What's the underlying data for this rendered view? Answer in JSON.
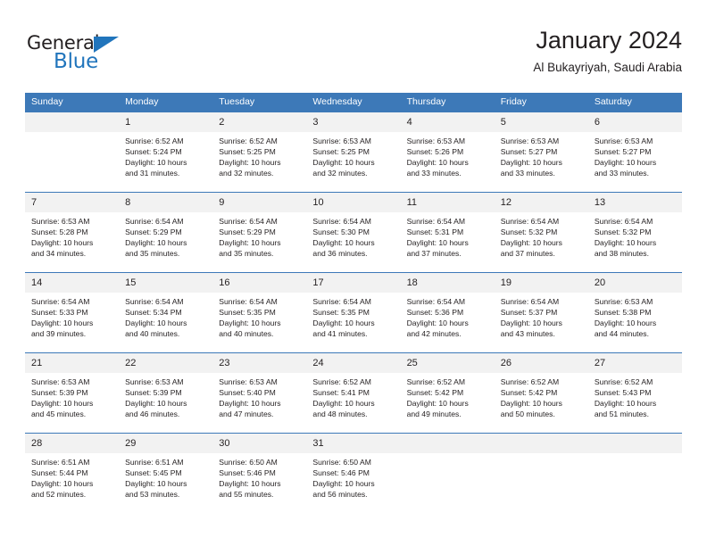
{
  "brand": {
    "name_part1": "General",
    "name_part2": "Blue",
    "triangle_color": "#2175bc",
    "text_color": "#231f20"
  },
  "header": {
    "title": "January 2024",
    "subtitle": "Al Bukayriyah, Saudi Arabia"
  },
  "theme": {
    "header_bg": "#3d79b8",
    "header_text": "#ffffff",
    "daynum_bg": "#f2f2f2",
    "row_border": "#3d79b8",
    "body_text": "#231f20"
  },
  "weekdays": [
    "Sunday",
    "Monday",
    "Tuesday",
    "Wednesday",
    "Thursday",
    "Friday",
    "Saturday"
  ],
  "labels": {
    "sunrise": "Sunrise:",
    "sunset": "Sunset:",
    "daylight": "Daylight:"
  },
  "weeks": [
    [
      {
        "day": "",
        "sunrise": "",
        "sunset": "",
        "daylight_line1": "",
        "daylight_line2": ""
      },
      {
        "day": "1",
        "sunrise": "Sunrise: 6:52 AM",
        "sunset": "Sunset: 5:24 PM",
        "daylight_line1": "Daylight: 10 hours",
        "daylight_line2": "and 31 minutes."
      },
      {
        "day": "2",
        "sunrise": "Sunrise: 6:52 AM",
        "sunset": "Sunset: 5:25 PM",
        "daylight_line1": "Daylight: 10 hours",
        "daylight_line2": "and 32 minutes."
      },
      {
        "day": "3",
        "sunrise": "Sunrise: 6:53 AM",
        "sunset": "Sunset: 5:25 PM",
        "daylight_line1": "Daylight: 10 hours",
        "daylight_line2": "and 32 minutes."
      },
      {
        "day": "4",
        "sunrise": "Sunrise: 6:53 AM",
        "sunset": "Sunset: 5:26 PM",
        "daylight_line1": "Daylight: 10 hours",
        "daylight_line2": "and 33 minutes."
      },
      {
        "day": "5",
        "sunrise": "Sunrise: 6:53 AM",
        "sunset": "Sunset: 5:27 PM",
        "daylight_line1": "Daylight: 10 hours",
        "daylight_line2": "and 33 minutes."
      },
      {
        "day": "6",
        "sunrise": "Sunrise: 6:53 AM",
        "sunset": "Sunset: 5:27 PM",
        "daylight_line1": "Daylight: 10 hours",
        "daylight_line2": "and 33 minutes."
      }
    ],
    [
      {
        "day": "7",
        "sunrise": "Sunrise: 6:53 AM",
        "sunset": "Sunset: 5:28 PM",
        "daylight_line1": "Daylight: 10 hours",
        "daylight_line2": "and 34 minutes."
      },
      {
        "day": "8",
        "sunrise": "Sunrise: 6:54 AM",
        "sunset": "Sunset: 5:29 PM",
        "daylight_line1": "Daylight: 10 hours",
        "daylight_line2": "and 35 minutes."
      },
      {
        "day": "9",
        "sunrise": "Sunrise: 6:54 AM",
        "sunset": "Sunset: 5:29 PM",
        "daylight_line1": "Daylight: 10 hours",
        "daylight_line2": "and 35 minutes."
      },
      {
        "day": "10",
        "sunrise": "Sunrise: 6:54 AM",
        "sunset": "Sunset: 5:30 PM",
        "daylight_line1": "Daylight: 10 hours",
        "daylight_line2": "and 36 minutes."
      },
      {
        "day": "11",
        "sunrise": "Sunrise: 6:54 AM",
        "sunset": "Sunset: 5:31 PM",
        "daylight_line1": "Daylight: 10 hours",
        "daylight_line2": "and 37 minutes."
      },
      {
        "day": "12",
        "sunrise": "Sunrise: 6:54 AM",
        "sunset": "Sunset: 5:32 PM",
        "daylight_line1": "Daylight: 10 hours",
        "daylight_line2": "and 37 minutes."
      },
      {
        "day": "13",
        "sunrise": "Sunrise: 6:54 AM",
        "sunset": "Sunset: 5:32 PM",
        "daylight_line1": "Daylight: 10 hours",
        "daylight_line2": "and 38 minutes."
      }
    ],
    [
      {
        "day": "14",
        "sunrise": "Sunrise: 6:54 AM",
        "sunset": "Sunset: 5:33 PM",
        "daylight_line1": "Daylight: 10 hours",
        "daylight_line2": "and 39 minutes."
      },
      {
        "day": "15",
        "sunrise": "Sunrise: 6:54 AM",
        "sunset": "Sunset: 5:34 PM",
        "daylight_line1": "Daylight: 10 hours",
        "daylight_line2": "and 40 minutes."
      },
      {
        "day": "16",
        "sunrise": "Sunrise: 6:54 AM",
        "sunset": "Sunset: 5:35 PM",
        "daylight_line1": "Daylight: 10 hours",
        "daylight_line2": "and 40 minutes."
      },
      {
        "day": "17",
        "sunrise": "Sunrise: 6:54 AM",
        "sunset": "Sunset: 5:35 PM",
        "daylight_line1": "Daylight: 10 hours",
        "daylight_line2": "and 41 minutes."
      },
      {
        "day": "18",
        "sunrise": "Sunrise: 6:54 AM",
        "sunset": "Sunset: 5:36 PM",
        "daylight_line1": "Daylight: 10 hours",
        "daylight_line2": "and 42 minutes."
      },
      {
        "day": "19",
        "sunrise": "Sunrise: 6:54 AM",
        "sunset": "Sunset: 5:37 PM",
        "daylight_line1": "Daylight: 10 hours",
        "daylight_line2": "and 43 minutes."
      },
      {
        "day": "20",
        "sunrise": "Sunrise: 6:53 AM",
        "sunset": "Sunset: 5:38 PM",
        "daylight_line1": "Daylight: 10 hours",
        "daylight_line2": "and 44 minutes."
      }
    ],
    [
      {
        "day": "21",
        "sunrise": "Sunrise: 6:53 AM",
        "sunset": "Sunset: 5:39 PM",
        "daylight_line1": "Daylight: 10 hours",
        "daylight_line2": "and 45 minutes."
      },
      {
        "day": "22",
        "sunrise": "Sunrise: 6:53 AM",
        "sunset": "Sunset: 5:39 PM",
        "daylight_line1": "Daylight: 10 hours",
        "daylight_line2": "and 46 minutes."
      },
      {
        "day": "23",
        "sunrise": "Sunrise: 6:53 AM",
        "sunset": "Sunset: 5:40 PM",
        "daylight_line1": "Daylight: 10 hours",
        "daylight_line2": "and 47 minutes."
      },
      {
        "day": "24",
        "sunrise": "Sunrise: 6:52 AM",
        "sunset": "Sunset: 5:41 PM",
        "daylight_line1": "Daylight: 10 hours",
        "daylight_line2": "and 48 minutes."
      },
      {
        "day": "25",
        "sunrise": "Sunrise: 6:52 AM",
        "sunset": "Sunset: 5:42 PM",
        "daylight_line1": "Daylight: 10 hours",
        "daylight_line2": "and 49 minutes."
      },
      {
        "day": "26",
        "sunrise": "Sunrise: 6:52 AM",
        "sunset": "Sunset: 5:42 PM",
        "daylight_line1": "Daylight: 10 hours",
        "daylight_line2": "and 50 minutes."
      },
      {
        "day": "27",
        "sunrise": "Sunrise: 6:52 AM",
        "sunset": "Sunset: 5:43 PM",
        "daylight_line1": "Daylight: 10 hours",
        "daylight_line2": "and 51 minutes."
      }
    ],
    [
      {
        "day": "28",
        "sunrise": "Sunrise: 6:51 AM",
        "sunset": "Sunset: 5:44 PM",
        "daylight_line1": "Daylight: 10 hours",
        "daylight_line2": "and 52 minutes."
      },
      {
        "day": "29",
        "sunrise": "Sunrise: 6:51 AM",
        "sunset": "Sunset: 5:45 PM",
        "daylight_line1": "Daylight: 10 hours",
        "daylight_line2": "and 53 minutes."
      },
      {
        "day": "30",
        "sunrise": "Sunrise: 6:50 AM",
        "sunset": "Sunset: 5:46 PM",
        "daylight_line1": "Daylight: 10 hours",
        "daylight_line2": "and 55 minutes."
      },
      {
        "day": "31",
        "sunrise": "Sunrise: 6:50 AM",
        "sunset": "Sunset: 5:46 PM",
        "daylight_line1": "Daylight: 10 hours",
        "daylight_line2": "and 56 minutes."
      },
      {
        "day": "",
        "sunrise": "",
        "sunset": "",
        "daylight_line1": "",
        "daylight_line2": ""
      },
      {
        "day": "",
        "sunrise": "",
        "sunset": "",
        "daylight_line1": "",
        "daylight_line2": ""
      },
      {
        "day": "",
        "sunrise": "",
        "sunset": "",
        "daylight_line1": "",
        "daylight_line2": ""
      }
    ]
  ]
}
